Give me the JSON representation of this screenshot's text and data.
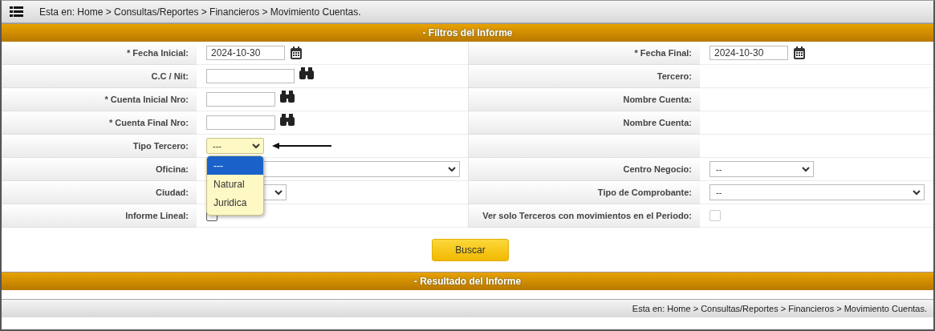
{
  "breadcrumb": "Esta en: Home > Consultas/Reportes > Financieros > Movimiento Cuentas.",
  "filters_header": "- Filtros del Informe",
  "rows": [
    {
      "left": {
        "label": "* Fecha Inicial:",
        "kind": "date",
        "value": "2024-10-30"
      },
      "right": {
        "label": "* Fecha Final:",
        "kind": "date",
        "value": "2024-10-30"
      }
    },
    {
      "left": {
        "label": "C.C / Nit:",
        "kind": "lookup"
      },
      "right": {
        "label": "Tercero:",
        "kind": "none"
      }
    },
    {
      "left": {
        "label": "* Cuenta Inicial Nro:",
        "kind": "lookup"
      },
      "right": {
        "label": "Nombre Cuenta:",
        "kind": "none"
      }
    },
    {
      "left": {
        "label": "* Cuenta Final Nro:",
        "kind": "lookup"
      },
      "right": {
        "label": "Nombre Cuenta:",
        "kind": "none"
      }
    },
    {
      "left": {
        "label": "Tipo Tercero:",
        "kind": "select",
        "value": "---",
        "open": true,
        "options": [
          {
            "label": "---",
            "selected": true
          },
          {
            "label": "Natural",
            "selected": false
          },
          {
            "label": "Juridica",
            "selected": false
          }
        ]
      },
      "right": null
    },
    {
      "left": {
        "label": "Oficina:",
        "kind": "select",
        "open": false
      },
      "right": {
        "label": "Centro Negocio:",
        "kind": "select",
        "value": "--",
        "open": false
      }
    },
    {
      "left": {
        "label": "Ciudad:",
        "kind": "select",
        "open": false
      },
      "right": {
        "label": "Tipo de Comprobante:",
        "kind": "select",
        "value": "--",
        "open": false
      }
    },
    {
      "left": {
        "label": "Informe Lineal:",
        "kind": "checkbox",
        "checked": false,
        "disabled": false
      },
      "right": {
        "label": "Ver solo Terceros con movimientos en el Periodo:",
        "kind": "checkbox",
        "checked": false,
        "disabled": true
      }
    }
  ],
  "search_button": "Buscar",
  "results_header": "- Resultado del Informe",
  "footer_breadcrumb": "Esta en: Home > Consultas/Reportes > Financieros > Movimiento Cuentas."
}
